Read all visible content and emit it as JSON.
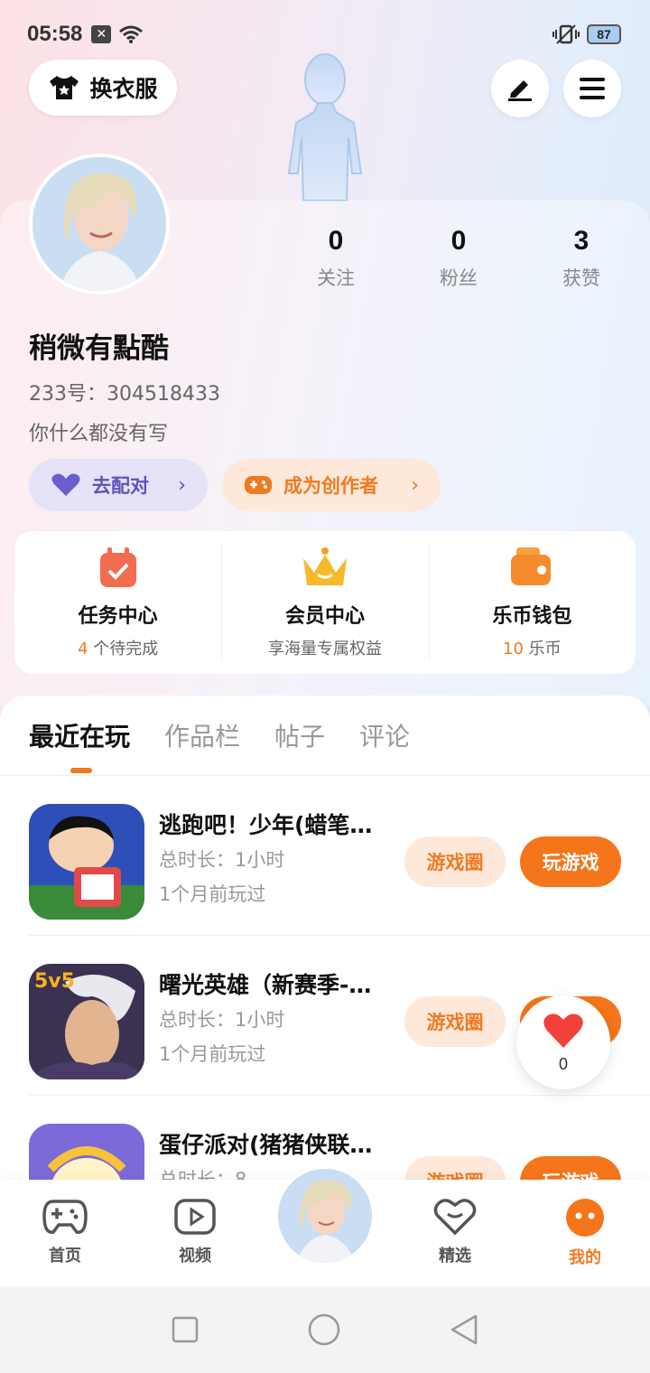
{
  "status_bar": {
    "time": "05:58",
    "battery": "87"
  },
  "top": {
    "outfit_label": "换衣服"
  },
  "profile": {
    "username": "稍微有點酷",
    "uid": "233号：304518433",
    "bio": "你什么都没有写",
    "stats": [
      {
        "value": "0",
        "label": "关注"
      },
      {
        "value": "0",
        "label": "粉丝"
      },
      {
        "value": "3",
        "label": "获赞"
      }
    ],
    "match_label": "去配对",
    "creator_label": "成为创作者"
  },
  "features": [
    {
      "title": "任务中心",
      "sub_num": "4",
      "sub_text": " 个待完成"
    },
    {
      "title": "会员中心",
      "sub_num": "",
      "sub_text": "享海量专属权益"
    },
    {
      "title": "乐币钱包",
      "sub_num": "10",
      "sub_text": " 乐币"
    }
  ],
  "tabs": [
    "最近在玩",
    "作品栏",
    "帖子",
    "评论"
  ],
  "games": [
    {
      "name": "逃跑吧！少年(蜡笔…",
      "duration": "总时长：1小时",
      "last_played": "1个月前玩过"
    },
    {
      "name": "曙光英雄（新赛季-…",
      "duration": "总时长：1小时",
      "last_played": "1个月前玩过"
    },
    {
      "name": "蛋仔派对(猪猪侠联…",
      "duration": "总时长：8",
      "last_played": ""
    }
  ],
  "game_buttons": {
    "circle": "游戏圈",
    "play": "玩游戏"
  },
  "like": {
    "count": "0"
  },
  "nav": [
    {
      "label": "首页"
    },
    {
      "label": "视频"
    },
    {
      "label": "精选"
    },
    {
      "label": "我的"
    }
  ],
  "colors": {
    "accent": "#f5751a",
    "match": "#5d54b8"
  }
}
